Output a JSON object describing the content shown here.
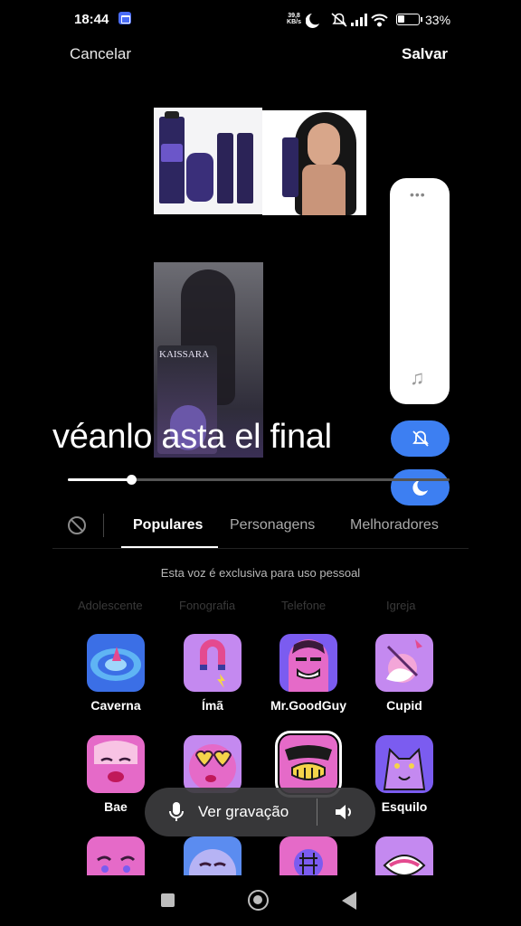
{
  "status_bar": {
    "time": "18:44",
    "net_speed": "39,8",
    "net_unit": "KB/s",
    "battery": "33"
  },
  "header": {
    "cancel": "Cancelar",
    "save": "Salvar"
  },
  "preview": {
    "product_label": "KAISSARA",
    "caption": "véanlo asta el final"
  },
  "tabs": {
    "items": [
      "Populares",
      "Personagens",
      "Melhoradores"
    ],
    "active": "Populares"
  },
  "hint": "Esta voz é exclusiva para uso pessoal",
  "faded_row": [
    "Adolescente",
    "Fonografia",
    "Telefone",
    "Igreja"
  ],
  "effects": [
    {
      "label": "Caverna",
      "icon": "cave-swirl-icon"
    },
    {
      "label": "Ímã",
      "icon": "magnet-icon"
    },
    {
      "label": "Mr.GoodGuy",
      "icon": "goodguy-face-icon"
    },
    {
      "label": "Cupid",
      "icon": "cupid-icon"
    },
    {
      "label": "Bae",
      "icon": "bae-face-icon"
    },
    {
      "label": "",
      "icon": "heart-glasses-face-icon"
    },
    {
      "label": "",
      "icon": "villain-face-icon"
    },
    {
      "label": "Esquilo",
      "icon": "squirrel-icon"
    }
  ],
  "record_bar": {
    "label": "Ver gravação"
  },
  "colors": {
    "accent_blue": "#3d7ff2",
    "effect_pink": "#e56ac8",
    "effect_purple": "#7b5cf0"
  }
}
